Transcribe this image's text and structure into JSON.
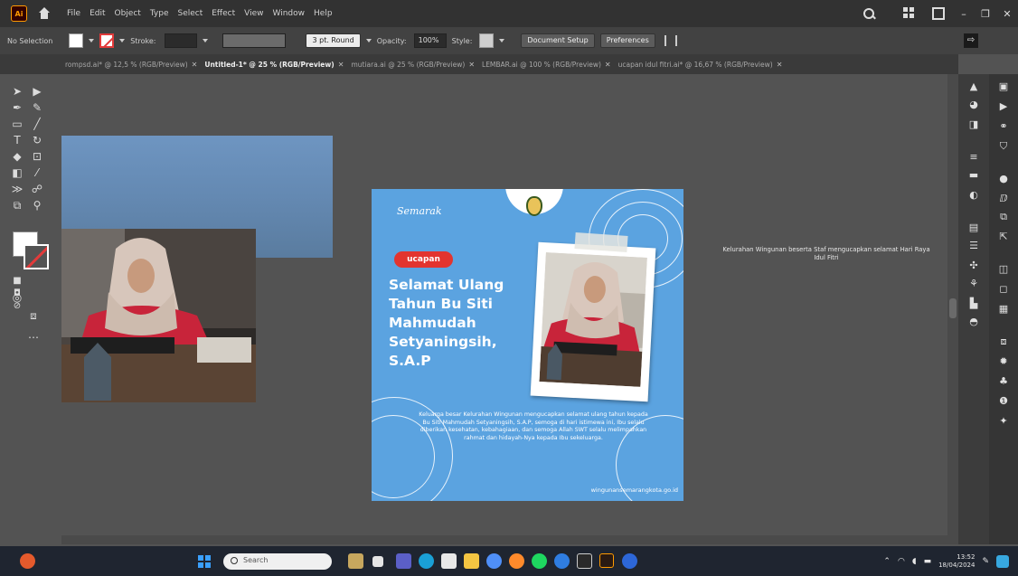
{
  "menubar": {
    "logo": "Ai",
    "items": [
      "File",
      "Edit",
      "Object",
      "Type",
      "Select",
      "Effect",
      "View",
      "Window",
      "Help"
    ]
  },
  "controlbar": {
    "selection_label": "No Selection",
    "stroke_label": "Stroke:",
    "stroke_value": "",
    "brush_value": "3 pt. Round",
    "opacity_label": "Opacity:",
    "opacity_value": "100%",
    "style_label": "Style:",
    "document_setup": "Document Setup",
    "preferences": "Preferences"
  },
  "tabs": [
    {
      "label": "rompsd.ai* @ 12,5 % (RGB/Preview)",
      "active": false
    },
    {
      "label": "Untitled-1* @ 25 % (RGB/Preview)",
      "active": true
    },
    {
      "label": "mutiara.ai @ 25 % (RGB/Preview)",
      "active": false
    },
    {
      "label": "LEMBAR.ai @ 100 % (RGB/Preview)",
      "active": false
    },
    {
      "label": "ucapan idul fitri.ai* @ 16,67 % (RGB/Preview)",
      "active": false
    }
  ],
  "post": {
    "brand": "Semarak",
    "pill": "ucapan",
    "headline": [
      "Selamat Ulang",
      "Tahun Bu Siti",
      "Mahmudah",
      "Setyaningsih,",
      "S.A.P"
    ],
    "body": "Keluarga besar Kelurahan Wingunan mengucapkan selamat ulang tahun kepada Bu Siti Mahmudah Setyaningsih, S.A.P, semoga di hari istimewa ini, Ibu selalu diberikan kesehatan, kebahagiaan, dan semoga Allah SWT selalu melimpahkan rahmat dan hidayah-Nya kepada Ibu sekeluarga.",
    "url": "wingunansemarangkota.go.id",
    "colors": {
      "bg": "#5ba3e0",
      "pill": "#e2342f"
    }
  },
  "canvas_note": "Kelurahan Wingunan beserta Staf mengucapkan selamat Hari Raya Idul Fitri",
  "taskbar": {
    "search_placeholder": "Search",
    "time": "13:52",
    "date": "18/04/2024"
  }
}
